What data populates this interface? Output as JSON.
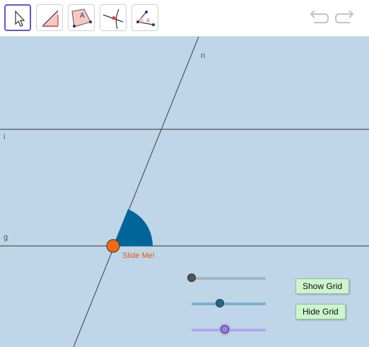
{
  "toolbar": {
    "tools": [
      {
        "name": "move-tool",
        "icon": "cursor-arrow-icon",
        "selected": true
      },
      {
        "name": "angle-tool",
        "icon": "angle-icon",
        "selected": false
      },
      {
        "name": "polygon-tool",
        "icon": "polygon-icon",
        "selected": false
      },
      {
        "name": "intersect-tool",
        "icon": "intersect-icon",
        "selected": false
      },
      {
        "name": "angle-measure-tool",
        "icon": "angle-measure-icon",
        "selected": false
      }
    ],
    "undo_icon": "undo-icon",
    "redo_icon": "redo-icon",
    "polygon_point_label": "A",
    "angle_symbol": "α"
  },
  "graphics": {
    "background_color": "#bed6e8",
    "line_labels": {
      "transversal": "n",
      "upper_line": "i",
      "lower_line": "g"
    },
    "point_label": "Slide Me!",
    "point_color": "#f26a10",
    "angle_color": "#006699"
  },
  "sliders": [
    {
      "name": "slider-gray",
      "value": 0.0,
      "track_color": "#a9b6bf",
      "knob_color": "#555555"
    },
    {
      "name": "slider-blue",
      "value": 0.38,
      "track_color": "#7fb0cc",
      "knob_color": "#1f6a8f"
    },
    {
      "name": "slider-purple",
      "value": 0.45,
      "track_color": "#b3a6ea",
      "knob_color": "#9a7ef0"
    }
  ],
  "buttons": {
    "show_grid": "Show Grid",
    "hide_grid": "Hide Grid"
  }
}
